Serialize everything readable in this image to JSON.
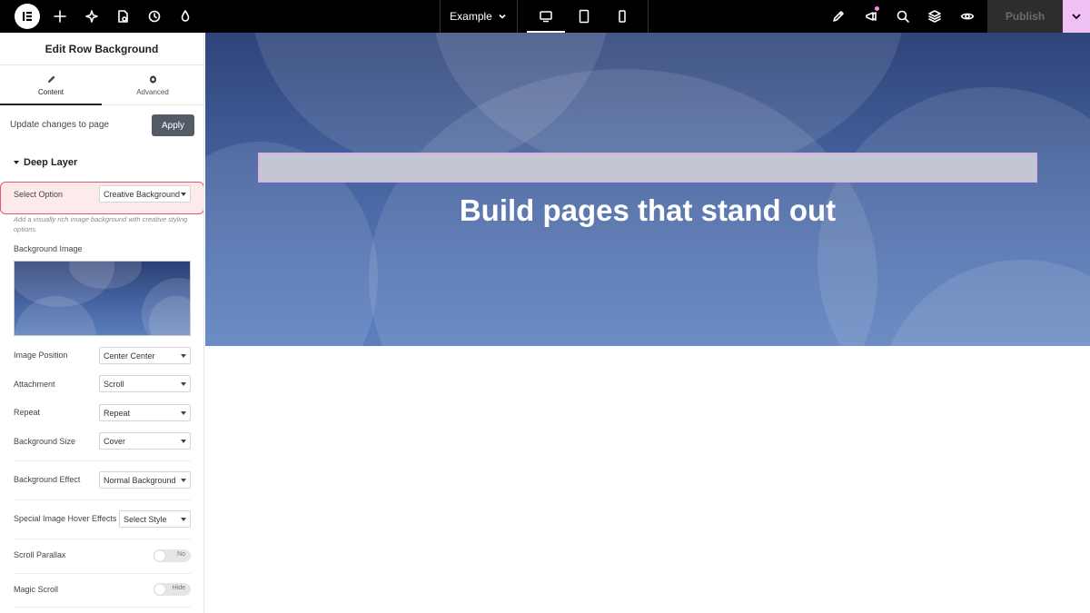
{
  "topbar": {
    "document_name": "Example",
    "publish_label": "Publish",
    "icons": [
      "add-icon",
      "ai-sparkle-icon",
      "page-settings-icon",
      "history-icon",
      "theme-icon",
      "site-settings-icon",
      "notifications-icon",
      "search-icon",
      "structure-icon",
      "preview-icon"
    ],
    "devices": [
      "desktop",
      "tablet",
      "mobile"
    ]
  },
  "panel": {
    "title": "Edit Row Background",
    "tabs": [
      {
        "label": "Content"
      },
      {
        "label": "Advanced"
      }
    ],
    "update_text": "Update changes to page",
    "apply_label": "Apply",
    "section_title": "Deep Layer",
    "select_option": {
      "label": "Select Option",
      "value": "Creative Background"
    },
    "helper_text": "Add a visually rich image background with creative styling options.",
    "background_image_label": "Background Image",
    "fields": [
      {
        "label": "Image Position",
        "value": "Center Center"
      },
      {
        "label": "Attachment",
        "value": "Scroll"
      },
      {
        "label": "Repeat",
        "value": "Repeat"
      },
      {
        "label": "Background Size",
        "value": "Cover"
      },
      {
        "label": "Background Effect",
        "value": "Normal Background"
      },
      {
        "label": "Special Image Hover Effects",
        "value": "Select Style"
      }
    ],
    "toggles": [
      {
        "label": "Scroll Parallax",
        "value": "No"
      },
      {
        "label": "Magic Scroll",
        "value": "Hide"
      }
    ]
  },
  "canvas": {
    "hero_title": "Build pages that stand out"
  },
  "colors": {
    "topbar": "#000000",
    "publish_more": "#f0c0f5",
    "highlight_border": "#e25a6e",
    "apply_button": "#545b66",
    "hero_top": "#2e4479",
    "hero_bottom": "#5c80bf"
  }
}
